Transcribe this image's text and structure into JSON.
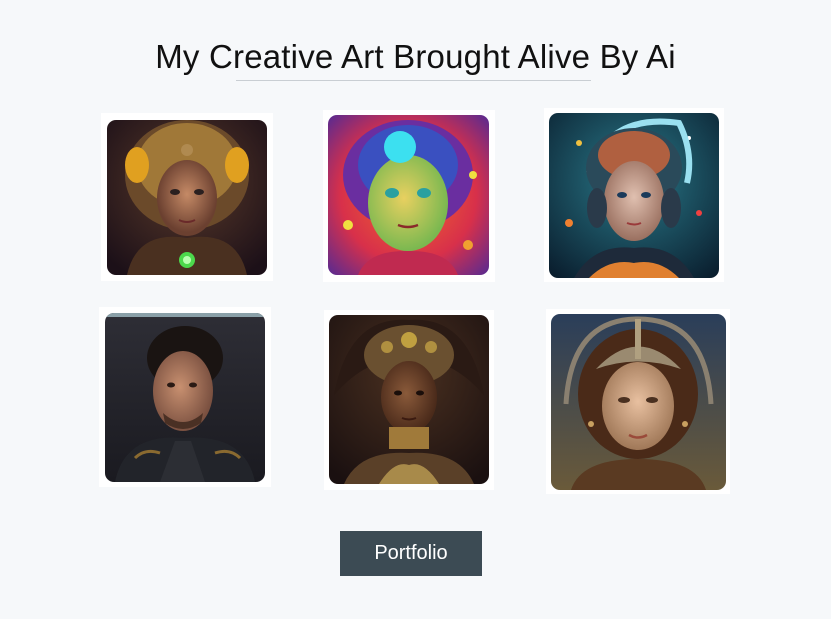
{
  "page": {
    "title": "My Creative Art Brought Alive By Ai"
  },
  "gallery": {
    "images": [
      {
        "alt": "Cyborg woman with golden circuitry"
      },
      {
        "alt": "Neon-colored cartoon girl"
      },
      {
        "alt": "Woman with astronaut headpiece in cosmic scene"
      },
      {
        "alt": "Man with slicked-back hair in dark jacket"
      },
      {
        "alt": "Woman with ornate golden headdress"
      },
      {
        "alt": "Woman with ornate silver halo crown"
      }
    ]
  },
  "actions": {
    "portfolio_label": "Portfolio"
  },
  "colors": {
    "background": "#f6f8fa",
    "button": "#3c4b54",
    "button_text": "#ffffff"
  }
}
